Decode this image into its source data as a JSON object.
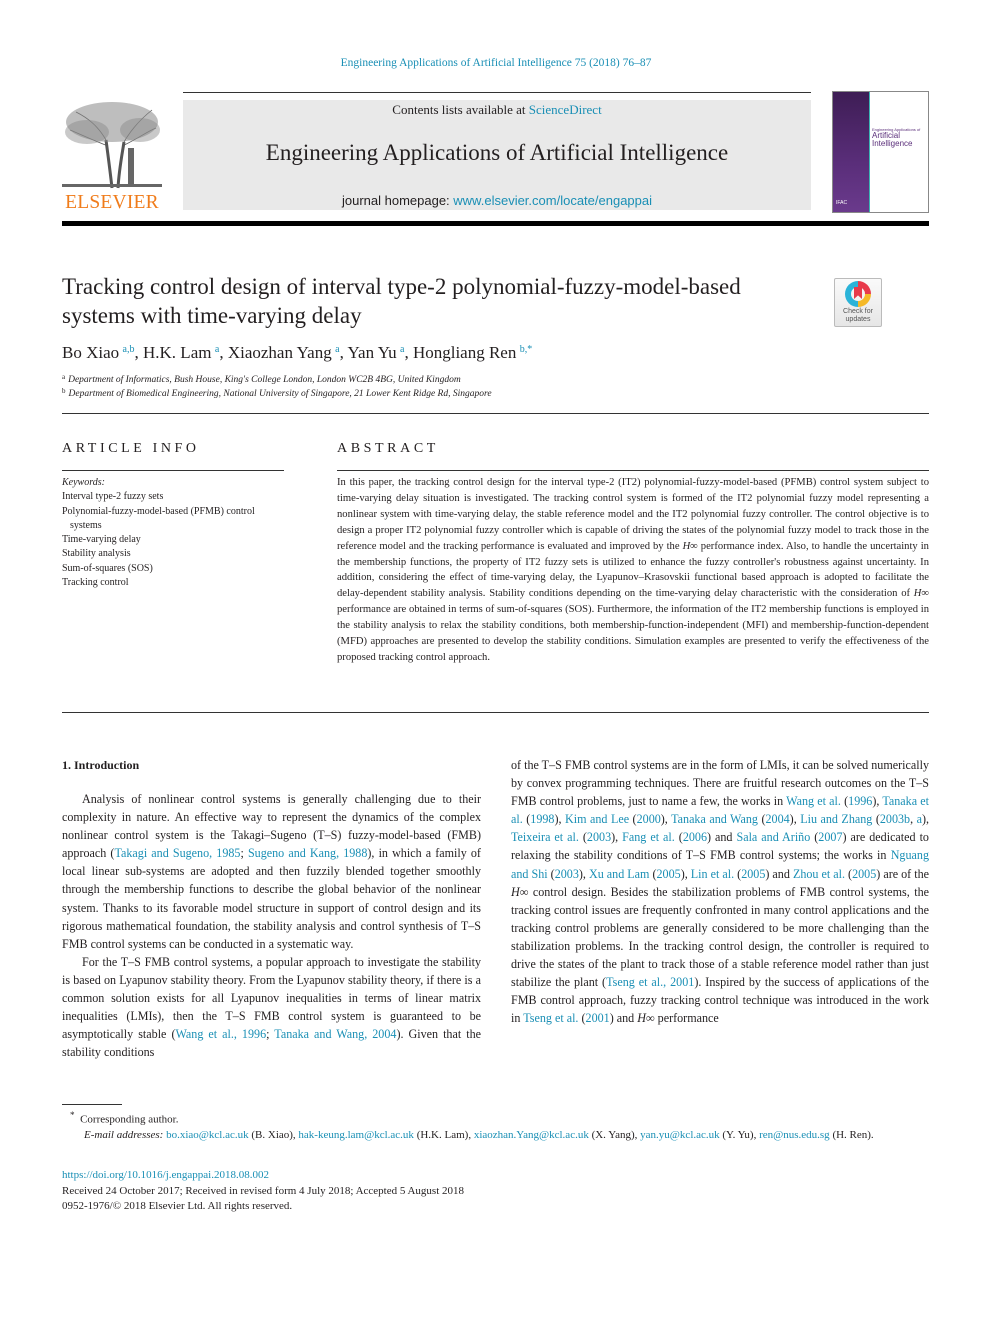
{
  "running_header": "Engineering Applications of Artificial Intelligence 75 (2018) 76–87",
  "masthead": {
    "publisher_logo_text": "ELSEVIER",
    "contents_prefix": "Contents lists available at ",
    "contents_link": "ScienceDirect",
    "journal_name": "Engineering Applications of Artificial Intelligence",
    "homepage_prefix": "journal homepage: ",
    "homepage_link": "www.elsevier.com/locate/engappai",
    "cover": {
      "small_title": "Engineering Applications of",
      "big_title_line1": "Artificial",
      "big_title_line2": "Intelligence",
      "footer": "IFAC"
    },
    "colors": {
      "link": "#1a8fb5",
      "elsevier_orange": "#f07c1b",
      "cover_purple": "#5a2e7a"
    }
  },
  "article": {
    "title": "Tracking control design of interval type-2 polynomial-fuzzy-model-based systems with time-varying delay",
    "check_updates_label": "Check for updates",
    "authors": [
      {
        "name": "Bo Xiao",
        "sup": "a,b"
      },
      {
        "name": "H.K. Lam",
        "sup": "a"
      },
      {
        "name": "Xiaozhan Yang",
        "sup": "a"
      },
      {
        "name": "Yan Yu",
        "sup": "a"
      },
      {
        "name": "Hongliang Ren",
        "sup": "b,*"
      }
    ],
    "affiliations": [
      {
        "mark": "a",
        "text": "Department of Informatics, Bush House, King's College London, London WC2B 4BG, United Kingdom"
      },
      {
        "mark": "b",
        "text": "Department of Biomedical Engineering, National University of Singapore, 21 Lower Kent Ridge Rd, Singapore"
      }
    ]
  },
  "article_info": {
    "heading": "ARTICLE INFO",
    "keywords_label": "Keywords:",
    "keywords": [
      "Interval type-2 fuzzy sets",
      "Polynomial-fuzzy-model-based (PFMB) control systems",
      "Time-varying delay",
      "Stability analysis",
      "Sum-of-squares (SOS)",
      "Tracking control"
    ]
  },
  "abstract": {
    "heading": "ABSTRACT",
    "parts": [
      "In this paper, the tracking control design for the interval type-2 (IT2) polynomial-fuzzy-model-based (PFMB) control system subject to time-varying delay situation is investigated. The tracking control system is formed of the IT2 polynomial fuzzy model representing a nonlinear system with time-varying delay, the stable reference model and the IT2 polynomial fuzzy controller. The control objective is to design a proper IT2 polynomial fuzzy controller which is capable of driving the states of the polynomial fuzzy model to track those in the reference model and the tracking performance is evaluated and improved by the ",
      "H∞",
      " performance index. Also, to handle the uncertainty in the membership functions, the property of IT2 fuzzy sets is utilized to enhance the fuzzy controller's robustness against uncertainty. In addition, considering the effect of time-varying delay, the Lyapunov–Krasovskii functional based approach is adopted to facilitate the delay-dependent stability analysis. Stability conditions depending on the time-varying delay characteristic with the consideration of ",
      "H∞",
      " performance are obtained in terms of sum-of-squares (SOS). Furthermore, the information of the IT2 membership functions is employed in the stability analysis to relax the stability conditions, both membership-function-independent (MFI) and membership-function-dependent (MFD) approaches are presented to develop the stability conditions. Simulation examples are presented to verify the effectiveness of the proposed tracking control approach."
    ]
  },
  "body": {
    "section_heading": "1.  Introduction",
    "left": {
      "p1": [
        "Analysis of nonlinear control systems is generally challenging due to their complexity in nature. An effective way to represent the dynamics of the complex nonlinear control system is the Takagi–Sugeno (T–S) fuzzy-model-based (FMB) approach (",
        "Takagi and Sugeno, 1985",
        "; ",
        "Sugeno and Kang, 1988",
        "), in which a family of local linear sub-systems are adopted and then fuzzily blended together smoothly through the membership functions to describe the global behavior of the nonlinear system. Thanks to its favorable model structure in support of control design and its rigorous mathematical foundation, the stability analysis and control synthesis of T–S FMB control systems can be conducted in a systematic way."
      ],
      "p2": [
        "For the T–S FMB control systems, a popular approach to investigate the stability is based on Lyapunov stability theory. From the Lyapunov stability theory, if there is a common solution exists for all Lyapunov inequalities in terms of linear matrix inequalities (LMIs), then the T–S FMB control system is guaranteed to be asymptotically stable (",
        "Wang et al., 1996",
        "; ",
        "Tanaka and Wang, 2004",
        "). Given that the stability conditions"
      ]
    },
    "right": {
      "segments": [
        {
          "t": "of the T–S FMB control systems are in the form of LMIs, it can be solved numerically by convex programming techniques. There are fruitful research outcomes on the T–S FMB control problems, just to name a few, the works in "
        },
        {
          "t": "Wang et al.",
          "link": true
        },
        {
          "t": " ("
        },
        {
          "t": "1996",
          "link": true
        },
        {
          "t": "), "
        },
        {
          "t": "Tanaka et al.",
          "link": true
        },
        {
          "t": " ("
        },
        {
          "t": "1998",
          "link": true
        },
        {
          "t": "), "
        },
        {
          "t": "Kim and Lee",
          "link": true
        },
        {
          "t": " ("
        },
        {
          "t": "2000",
          "link": true
        },
        {
          "t": "), "
        },
        {
          "t": "Tanaka and Wang",
          "link": true
        },
        {
          "t": " ("
        },
        {
          "t": "2004",
          "link": true
        },
        {
          "t": "), "
        },
        {
          "t": "Liu and Zhang",
          "link": true
        },
        {
          "t": " ("
        },
        {
          "t": "2003b",
          "link": true
        },
        {
          "t": ", "
        },
        {
          "t": "a",
          "link": true
        },
        {
          "t": "), "
        },
        {
          "t": "Teixeira et al.",
          "link": true
        },
        {
          "t": " ("
        },
        {
          "t": "2003",
          "link": true
        },
        {
          "t": "), "
        },
        {
          "t": "Fang et al.",
          "link": true
        },
        {
          "t": " ("
        },
        {
          "t": "2006",
          "link": true
        },
        {
          "t": ") and "
        },
        {
          "t": "Sala and Ariño",
          "link": true
        },
        {
          "t": " ("
        },
        {
          "t": "2007",
          "link": true
        },
        {
          "t": ") are dedicated to relaxing the stability conditions of T–S FMB control systems; the works in "
        },
        {
          "t": "Nguang and Shi",
          "link": true
        },
        {
          "t": " ("
        },
        {
          "t": "2003",
          "link": true
        },
        {
          "t": "), "
        },
        {
          "t": "Xu and Lam",
          "link": true
        },
        {
          "t": " ("
        },
        {
          "t": "2005",
          "link": true
        },
        {
          "t": "), "
        },
        {
          "t": "Lin et al.",
          "link": true
        },
        {
          "t": " ("
        },
        {
          "t": "2005",
          "link": true
        },
        {
          "t": ") and "
        },
        {
          "t": "Zhou et al.",
          "link": true
        },
        {
          "t": " ("
        },
        {
          "t": "2005",
          "link": true
        },
        {
          "t": ") are of the "
        },
        {
          "t": "H∞",
          "math": true
        },
        {
          "t": " control design. Besides the stabilization problems of FMB control systems, the tracking control issues are frequently confronted in many control applications and the tracking control problems are generally considered to be more challenging than the stabilization problems. In the tracking control design, the controller is required to drive the states of the plant to track those of a stable reference model rather than just stabilize the plant ("
        },
        {
          "t": "Tseng et al., 2001",
          "link": true
        },
        {
          "t": "). Inspired by the success of applications of the FMB control approach, fuzzy tracking control technique was introduced in the work in "
        },
        {
          "t": "Tseng et al.",
          "link": true
        },
        {
          "t": " ("
        },
        {
          "t": "2001",
          "link": true
        },
        {
          "t": ") and "
        },
        {
          "t": "H∞",
          "math": true
        },
        {
          "t": " performance"
        }
      ]
    }
  },
  "footnotes": {
    "corresponding_mark": "*",
    "corresponding_text": "Corresponding author.",
    "email_label": "E-mail addresses:",
    "emails": [
      {
        "addr": "bo.xiao@kcl.ac.uk",
        "who": "(B. Xiao)"
      },
      {
        "addr": "hak-keung.lam@kcl.ac.uk",
        "who": "(H.K. Lam)"
      },
      {
        "addr": "xiaozhan.Yang@kcl.ac.uk",
        "who": "(X. Yang)"
      },
      {
        "addr": "yan.yu@kcl.ac.uk",
        "who": "(Y. Yu)"
      },
      {
        "addr": "ren@nus.edu.sg",
        "who": "(H. Ren)."
      }
    ],
    "doi": "https://doi.org/10.1016/j.engappai.2018.08.002",
    "received": "Received 24 October 2017; Received in revised form 4 July 2018; Accepted 5 August 2018",
    "copyright": "0952-1976/© 2018 Elsevier Ltd. All rights reserved."
  }
}
